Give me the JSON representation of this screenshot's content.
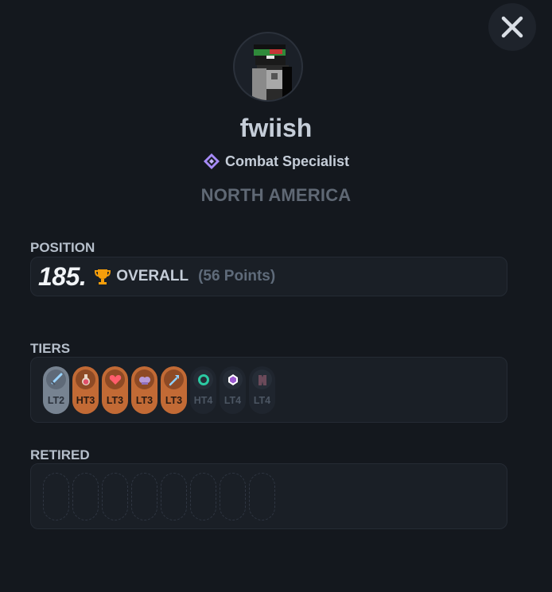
{
  "profile": {
    "username": "fwiish",
    "title": "Combat Specialist",
    "region": "NORTH AMERICA"
  },
  "position": {
    "label": "POSITION",
    "rank": "185.",
    "category": "OVERALL",
    "points": "(56 Points)"
  },
  "tiers": {
    "label": "TIERS",
    "items": [
      {
        "mode": "sword-icon",
        "tier": "LT2",
        "style": "gray"
      },
      {
        "mode": "potion-icon",
        "tier": "HT3",
        "style": "orange"
      },
      {
        "mode": "heart-icon",
        "tier": "LT3",
        "style": "orange"
      },
      {
        "mode": "skull-icon",
        "tier": "LT3",
        "style": "orange"
      },
      {
        "mode": "axe-icon",
        "tier": "LT3",
        "style": "orange"
      },
      {
        "mode": "ring-icon",
        "tier": "HT4",
        "style": "dark"
      },
      {
        "mode": "gem-icon",
        "tier": "LT4",
        "style": "dark"
      },
      {
        "mode": "chestplate-icon",
        "tier": "LT4",
        "style": "dark"
      }
    ]
  },
  "retired": {
    "label": "RETIRED",
    "slots": 8
  },
  "colors": {
    "background": "#14181e",
    "panel": "#1a1f26",
    "orange_tier": "#c26a35",
    "gray_tier": "#778391",
    "accent_purple": "#a78bfa",
    "trophy": "#f59e0b"
  }
}
